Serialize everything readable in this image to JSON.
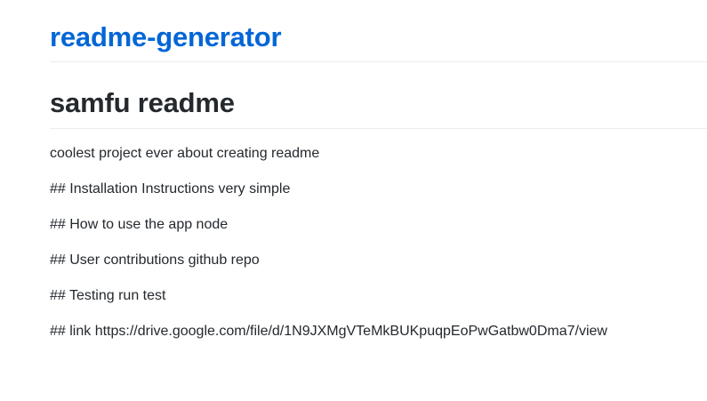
{
  "header": {
    "repo_title": "readme-generator"
  },
  "readme": {
    "title": "samfu readme",
    "paragraphs": [
      "coolest project ever about creating readme",
      "## Installation Instructions very simple",
      "## How to use the app node",
      "## User contributions github repo",
      "## Testing run test",
      "## link https://drive.google.com/file/d/1N9JXMgVTeMkBUKpuqpEoPwGatbw0Dma7/view"
    ]
  },
  "colors": {
    "link": "#0366d6",
    "text": "#24292e",
    "divider": "#eaecef"
  }
}
